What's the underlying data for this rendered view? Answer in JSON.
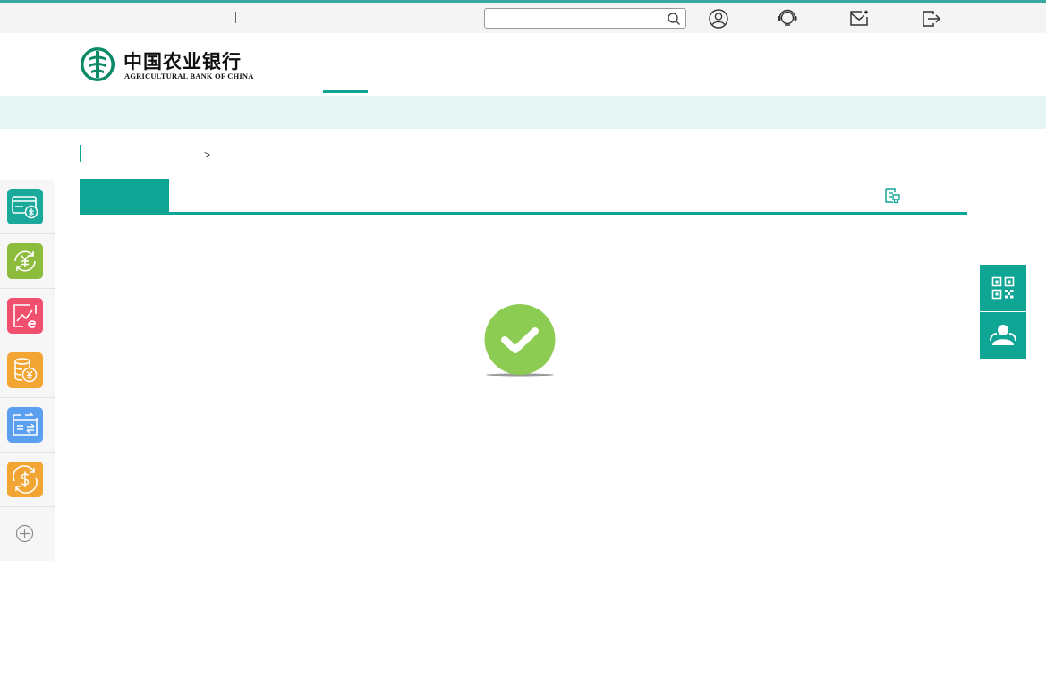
{
  "topbar": {
    "search": {
      "value": "",
      "placeholder": ""
    },
    "icons": [
      "user-icon",
      "customer-service-icon",
      "message-icon",
      "logout-icon"
    ]
  },
  "header": {
    "logo_cn": "中国农业银行",
    "logo_en": "AGRICULTURAL BANK OF CHINA"
  },
  "breadcrumb": {
    "separator": ">"
  },
  "tabs": {
    "icons": [
      "print-icon"
    ]
  },
  "sidebar": {
    "items": [
      {
        "icon": "account-card-icon",
        "color": "#1aa99a"
      },
      {
        "icon": "yuan-transfer-icon",
        "color": "#8dbb3b"
      },
      {
        "icon": "e-chart-icon",
        "color": "#f0506e"
      },
      {
        "icon": "coin-stack-icon",
        "color": "#f2a533"
      },
      {
        "icon": "card-exchange-icon",
        "color": "#5b9ff0"
      },
      {
        "icon": "dollar-exchange-icon",
        "color": "#f2a533"
      }
    ],
    "add_icon": "add-icon"
  },
  "float": {
    "icons": [
      "qr-code-icon",
      "contact-icon"
    ],
    "color": "#0fa594"
  },
  "result": {
    "icon": "success-check-icon",
    "color": "#8ccc52"
  },
  "colors": {
    "accent": "#0fa594",
    "subnav_bg": "#e5f5f3"
  }
}
